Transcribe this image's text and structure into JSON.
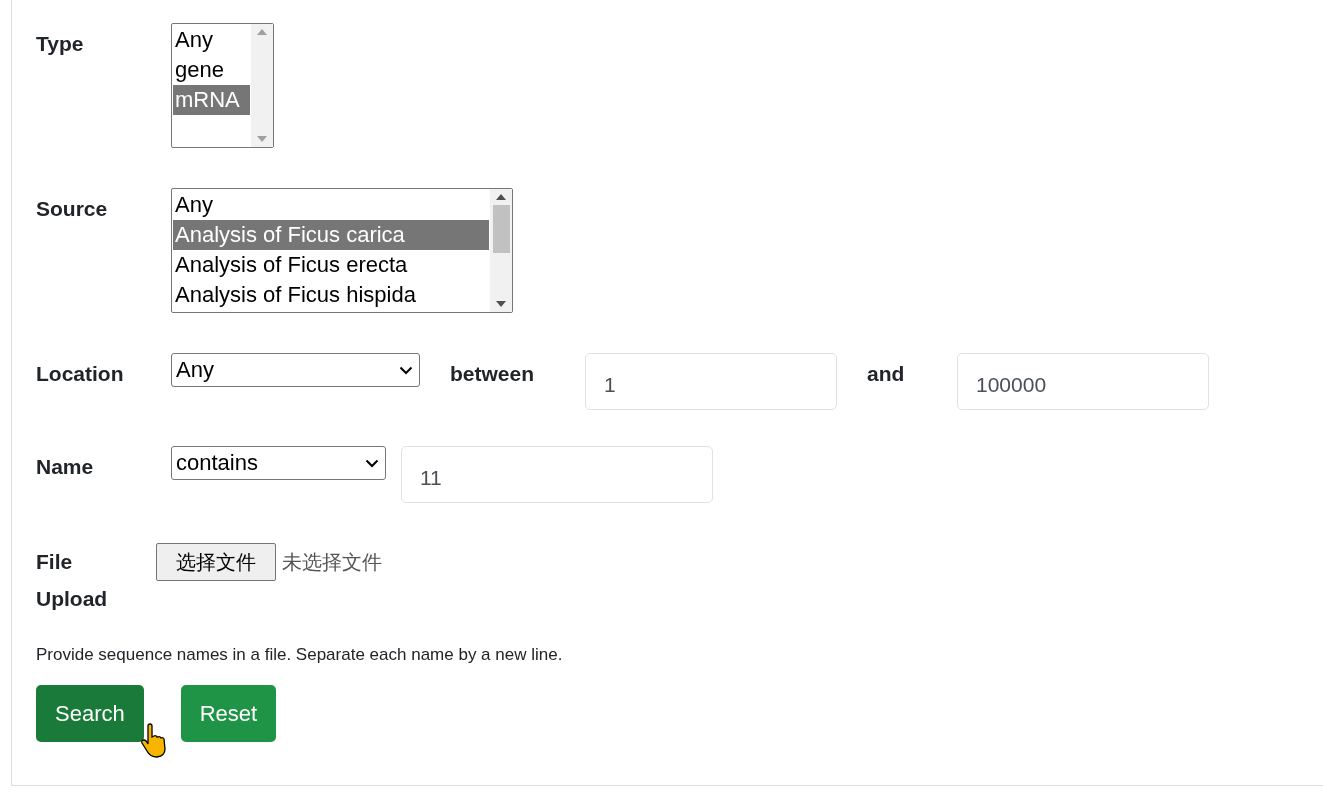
{
  "type": {
    "label": "Type",
    "options": [
      {
        "label": "Any",
        "selected": false
      },
      {
        "label": "gene",
        "selected": false
      },
      {
        "label": "mRNA",
        "selected": true
      }
    ]
  },
  "source": {
    "label": "Source",
    "options": [
      {
        "label": "Any",
        "selected": false
      },
      {
        "label": "Analysis of Ficus carica",
        "selected": true
      },
      {
        "label": "Analysis of Ficus erecta",
        "selected": false
      },
      {
        "label": "Analysis of Ficus hispida",
        "selected": false
      }
    ]
  },
  "location": {
    "label": "Location",
    "select": "Any",
    "between_label": "between",
    "start": "1",
    "and_label": "and",
    "end": "100000"
  },
  "name": {
    "label": "Name",
    "select": "contains",
    "value": "11"
  },
  "file_upload": {
    "label": "File Upload",
    "button": "选择文件",
    "status": "未选择文件"
  },
  "help_text": "Provide sequence names in a file. Separate each name by a new line.",
  "buttons": [
    {
      "label": "Search",
      "hovered": true
    },
    {
      "label": "Reset",
      "hovered": false
    }
  ]
}
